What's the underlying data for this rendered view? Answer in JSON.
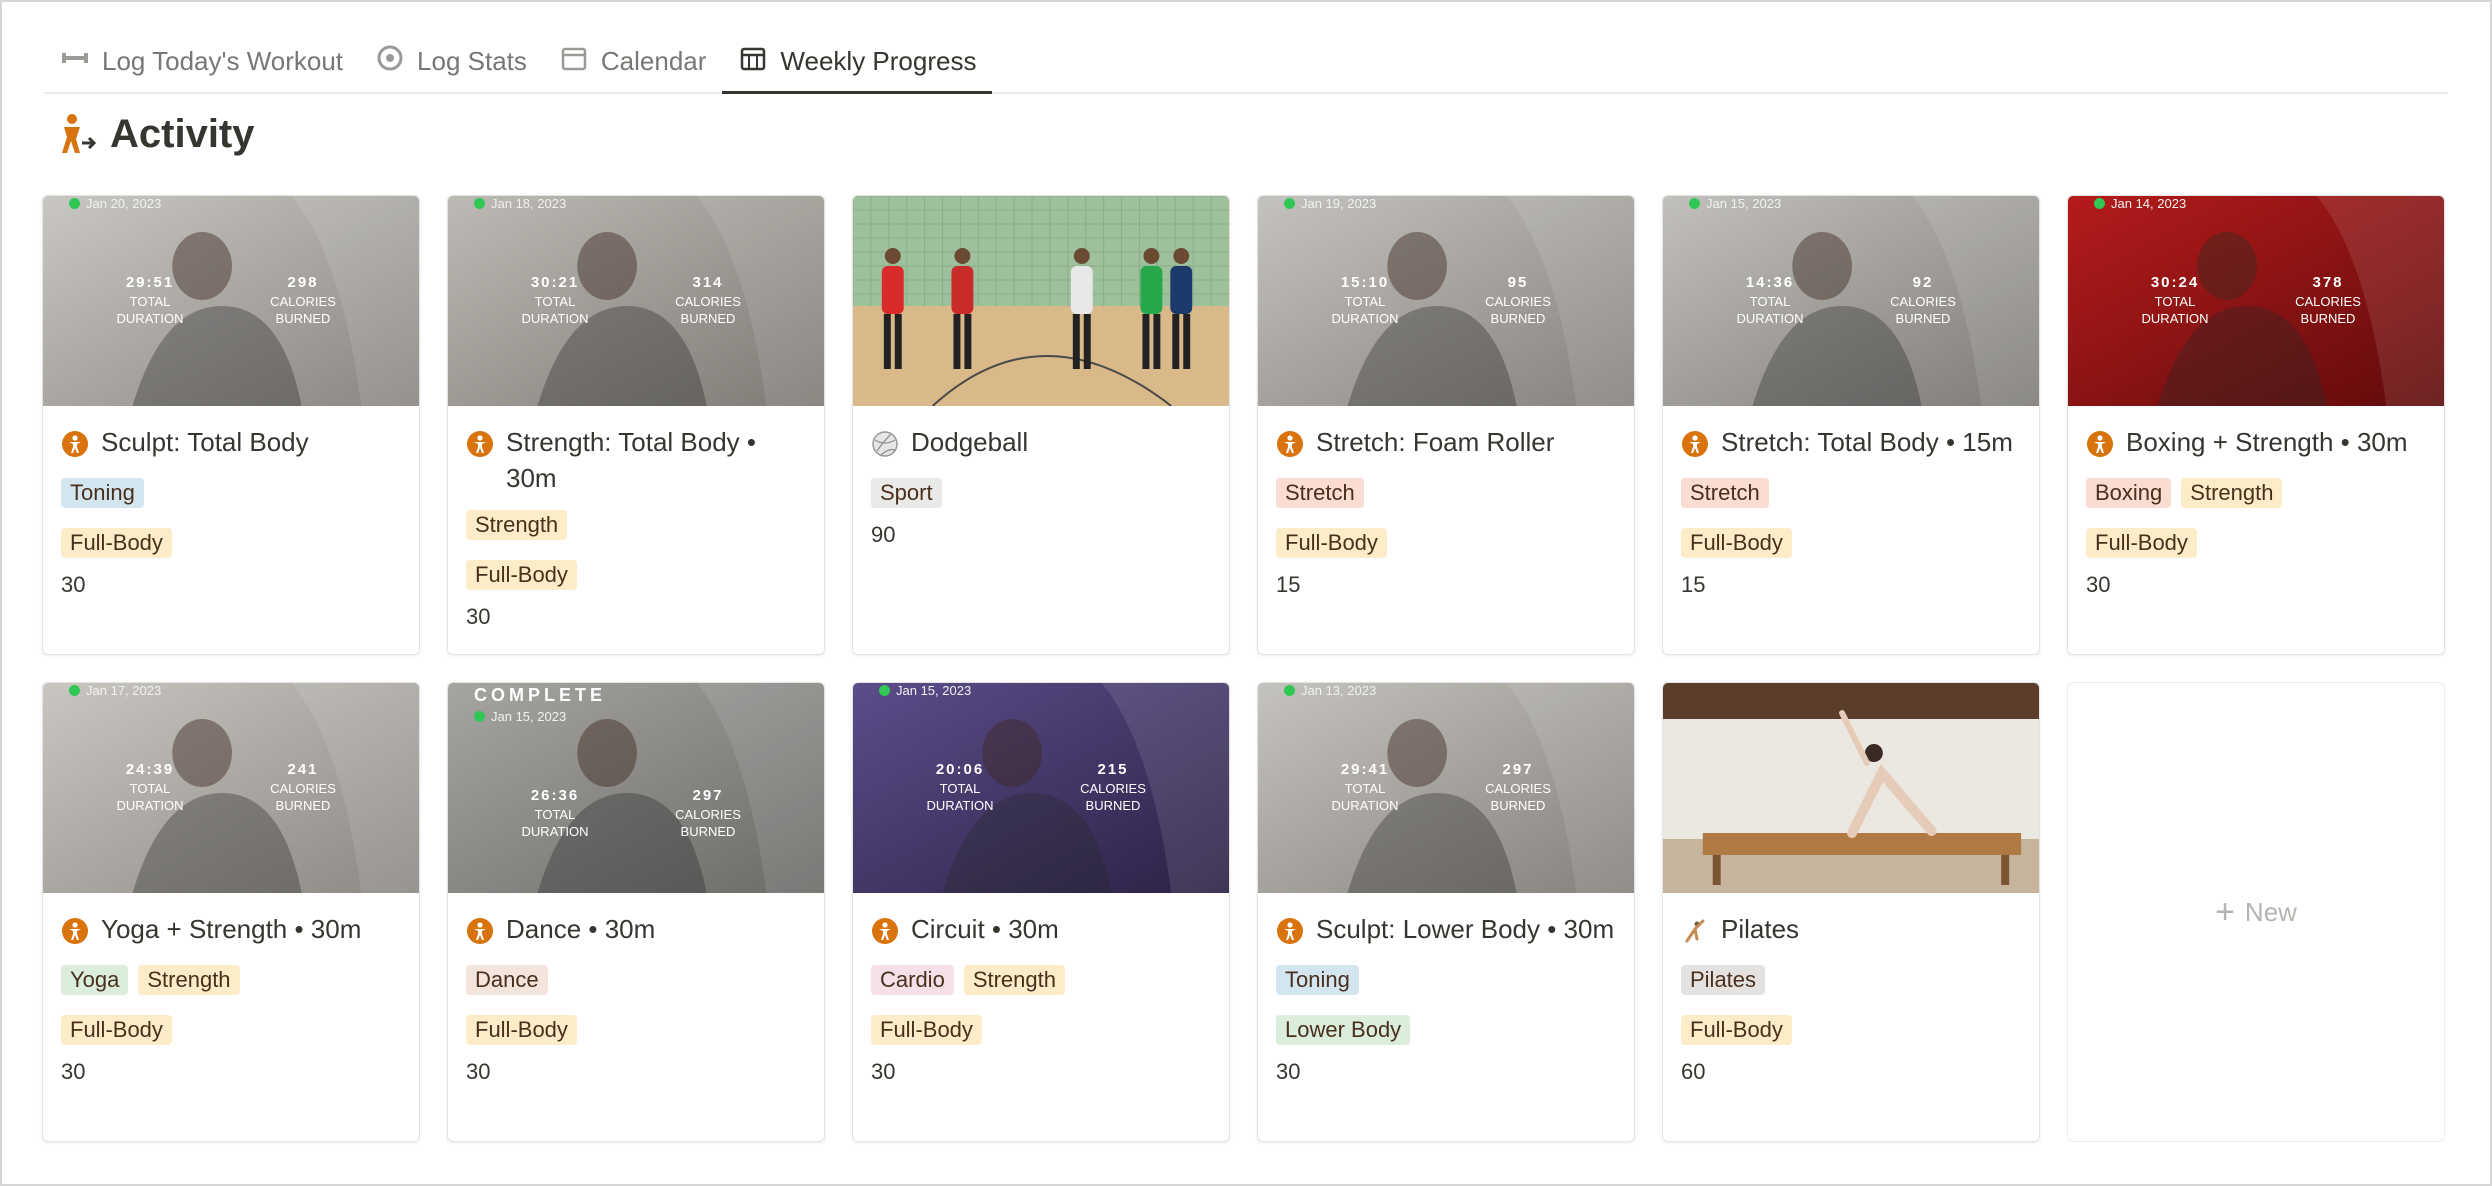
{
  "tabs": [
    {
      "label": "Log Today's Workout",
      "icon": "dumbbell-icon",
      "active": false
    },
    {
      "label": "Log Stats",
      "icon": "target-icon",
      "active": false
    },
    {
      "label": "Calendar",
      "icon": "calendar-icon",
      "active": false
    },
    {
      "label": "Weekly Progress",
      "icon": "calendar-grid-icon",
      "active": true
    }
  ],
  "page": {
    "title": "Activity",
    "icon": "activity-person-icon"
  },
  "tag_colors": {
    "Toning": "#d3e5ef",
    "Full-Body": "#fdecc8",
    "Strength": "#fdecc8",
    "Sport": "#e9e9e7",
    "Stretch": "#fadcd2",
    "Boxing": "#fadcd2",
    "Yoga": "#dbeddb",
    "Dance": "#f3e4dc",
    "Cardio": "#f5e0e9",
    "Lower Body": "#dbeddb",
    "Pilates": "#e3e2e0"
  },
  "cards": [
    {
      "title": "Sculpt: Total Body",
      "icon": "person-icon",
      "tags": [
        "Toning",
        "|",
        "Full-Body"
      ],
      "duration": "30",
      "cover": {
        "date": "Jan 20, 2023",
        "time": "29:51",
        "time_label": "TOTAL DURATION",
        "calories": "298",
        "calories_label": "CALORIES BURNED",
        "bg": [
          "#c9c7c3",
          "#8a8682"
        ]
      }
    },
    {
      "title": "Strength: Total Body • 30m",
      "icon": "person-icon",
      "tags": [
        "Strength",
        "|",
        "Full-Body"
      ],
      "duration": "30",
      "cover": {
        "date": "Jan 18, 2023",
        "time": "30:21",
        "time_label": "TOTAL DURATION",
        "calories": "314",
        "calories_label": "CALORIES BURNED",
        "bg": [
          "#bdbab5",
          "#7e7a75"
        ]
      }
    },
    {
      "title": "Dodgeball",
      "icon": "ball-icon",
      "tags": [
        "Sport"
      ],
      "duration": "90",
      "cover": {
        "photo": "gym",
        "bg": [
          "#a9c9a8",
          "#d9b98a"
        ]
      }
    },
    {
      "title": "Stretch: Foam Roller",
      "icon": "person-icon",
      "tags": [
        "Stretch",
        "|",
        "Full-Body"
      ],
      "duration": "15",
      "cover": {
        "date": "Jan 19, 2023",
        "time": "15:10",
        "time_label": "TOTAL DURATION",
        "calories": "95",
        "calories_label": "CALORIES BURNED",
        "bg": [
          "#c4c2bf",
          "#86827d"
        ]
      }
    },
    {
      "title": "Stretch: Total Body • 15m",
      "icon": "person-icon",
      "tags": [
        "Stretch",
        "|",
        "Full-Body"
      ],
      "duration": "15",
      "cover": {
        "date": "Jan 15, 2023",
        "time": "14:36",
        "time_label": "TOTAL DURATION",
        "calories": "92",
        "calories_label": "CALORIES BURNED",
        "bg": [
          "#c2c0bc",
          "#7f7c78"
        ]
      }
    },
    {
      "title": "Boxing + Strength • 30m",
      "icon": "person-icon",
      "tags": [
        "Boxing",
        "Strength",
        "|",
        "Full-Body"
      ],
      "duration": "30",
      "cover": {
        "date": "Jan 14, 2023",
        "time": "30:24",
        "time_label": "TOTAL DURATION",
        "calories": "378",
        "calories_label": "CALORIES BURNED",
        "bg": [
          "#b51b1b",
          "#5f0b0b"
        ]
      }
    },
    {
      "title": "Yoga + Strength • 30m",
      "icon": "person-icon",
      "tags": [
        "Yoga",
        "Strength",
        "|",
        "Full-Body"
      ],
      "duration": "30",
      "cover": {
        "date": "Jan 17, 2023",
        "time": "24:39",
        "time_label": "TOTAL DURATION",
        "calories": "241",
        "calories_label": "CALORIES BURNED",
        "bg": [
          "#c9c6c2",
          "#8c8884"
        ]
      }
    },
    {
      "title": "Dance • 30m",
      "icon": "person-icon",
      "tags": [
        "Dance",
        "|",
        "Full-Body"
      ],
      "duration": "30",
      "cover": {
        "complete": "COMPLETE",
        "date": "Jan 15, 2023",
        "time": "26:36",
        "time_label": "TOTAL DURATION",
        "calories": "297",
        "calories_label": "CALORIES BURNED",
        "bg": [
          "#a7a5a2",
          "#6c6a67"
        ]
      }
    },
    {
      "title": "Circuit • 30m",
      "icon": "person-icon",
      "tags": [
        "Cardio",
        "Strength",
        "|",
        "Full-Body"
      ],
      "duration": "30",
      "cover": {
        "date": "Jan 15, 2023",
        "time": "20:06",
        "time_label": "TOTAL DURATION",
        "calories": "215",
        "calories_label": "CALORIES BURNED",
        "bg": [
          "#5b4d8a",
          "#2b2145"
        ]
      }
    },
    {
      "title": "Sculpt: Lower Body • 30m",
      "icon": "person-icon",
      "tags": [
        "Toning",
        "|",
        "Lower Body"
      ],
      "duration": "30",
      "cover": {
        "date": "Jan 13, 2023",
        "time": "29:41",
        "time_label": "TOTAL DURATION",
        "calories": "297",
        "calories_label": "CALORIES BURNED",
        "bg": [
          "#c5c3bf",
          "#85817c"
        ]
      }
    },
    {
      "title": "Pilates",
      "icon": "pilates-figure-icon",
      "tags": [
        "Pilates",
        "|",
        "Full-Body"
      ],
      "duration": "60",
      "cover": {
        "photo": "studio",
        "bg": [
          "#e9e5df",
          "#b89a78"
        ]
      }
    }
  ],
  "new_card": {
    "label": "New",
    "icon": "plus-icon"
  }
}
